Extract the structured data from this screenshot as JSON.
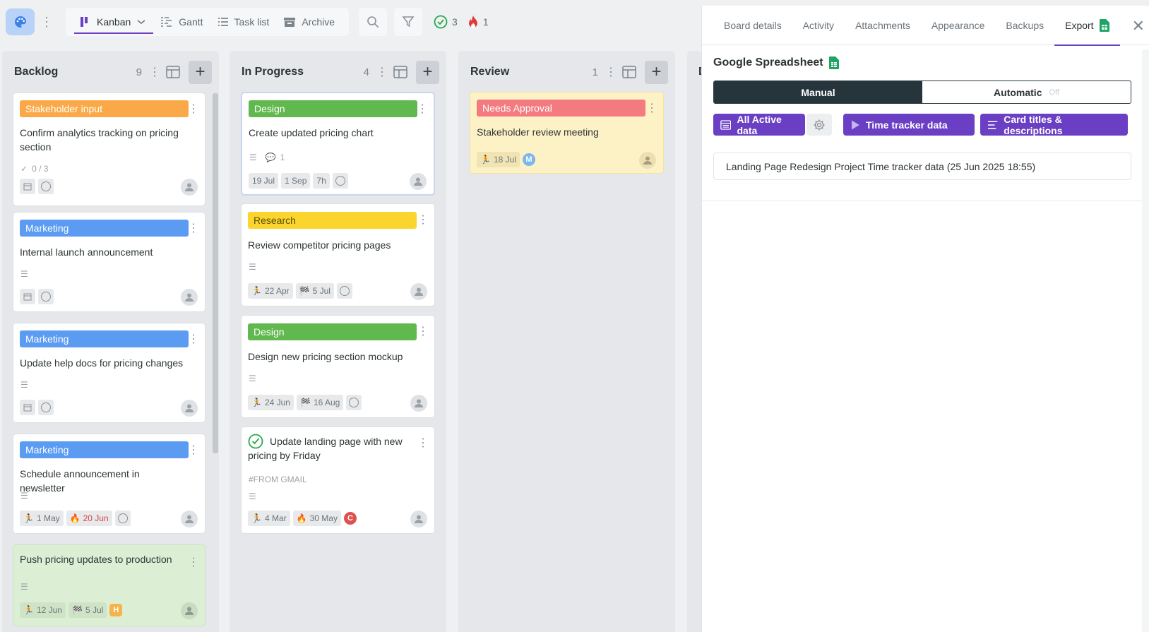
{
  "toolbar": {
    "views": [
      {
        "label": "Kanban",
        "icon": "kanban-icon",
        "active": true
      },
      {
        "label": "Gantt",
        "icon": "gantt-icon",
        "active": false
      },
      {
        "label": "Task list",
        "icon": "list-icon",
        "active": false
      },
      {
        "label": "Archive",
        "icon": "archive-icon",
        "active": false
      }
    ],
    "completed_count": "3",
    "overdue_count": "1"
  },
  "columns": [
    {
      "title": "Backlog",
      "count": "9"
    },
    {
      "title": "In Progress",
      "count": "4"
    },
    {
      "title": "Review",
      "count": "1"
    },
    {
      "title": "D"
    }
  ],
  "cards": {
    "b1": {
      "label": "Stakeholder input",
      "title": "Confirm analytics tracking on pricing section",
      "checklist": "0 / 3"
    },
    "b2": {
      "label": "Marketing",
      "title": "Internal launch announcement"
    },
    "b3": {
      "label": "Marketing",
      "title": "Update help docs for pricing changes"
    },
    "b4": {
      "label": "Marketing",
      "title": "Schedule announcement in newsletter",
      "start": "1 May",
      "due": "20 Jun"
    },
    "b5": {
      "title": "Push pricing updates to production",
      "start": "12 Jun",
      "end": "5 Jul",
      "avatar": "H"
    },
    "p1": {
      "label": "Design",
      "title": "Create updated pricing chart",
      "comments": "1",
      "start": "19 Jul",
      "end": "1 Sep",
      "estimate": "7h"
    },
    "p2": {
      "label": "Research",
      "title": "Review competitor pricing pages",
      "start": "22 Apr",
      "end": "5 Jul"
    },
    "p3": {
      "label": "Design",
      "title": "Design new pricing section mockup",
      "start": "24 Jun",
      "end": "16 Aug"
    },
    "p4": {
      "title": "Update landing page with new pricing by Friday",
      "tag": "#FROM GMAIL",
      "start": "4 Mar",
      "due": "30 May",
      "avatar": "C"
    },
    "r1": {
      "label": "Needs Approval",
      "title": "Stakeholder review meeting",
      "start": "18 Jul",
      "avatar": "M"
    }
  },
  "panel": {
    "tabs": [
      "Board details",
      "Activity",
      "Attachments",
      "Appearance",
      "Backups",
      "Export"
    ],
    "active_tab": "Export",
    "sheet_title": "Google Spreadsheet",
    "mode_manual": "Manual",
    "mode_automatic": "Automatic",
    "mode_off": "Off",
    "buttons": [
      "All Active data",
      "Time tracker data",
      "Card titles & descriptions"
    ],
    "export_entry": "Landing Page Redesign Project Time tracker data (25 Jun 2025 18:55)"
  },
  "colors": {
    "accent": "#6b3fc4",
    "orange_label": "#fba948",
    "blue_label": "#5b9cf2",
    "green_label": "#61b84f",
    "yellow_label": "#fbd52e",
    "red_label": "#f37b80"
  }
}
